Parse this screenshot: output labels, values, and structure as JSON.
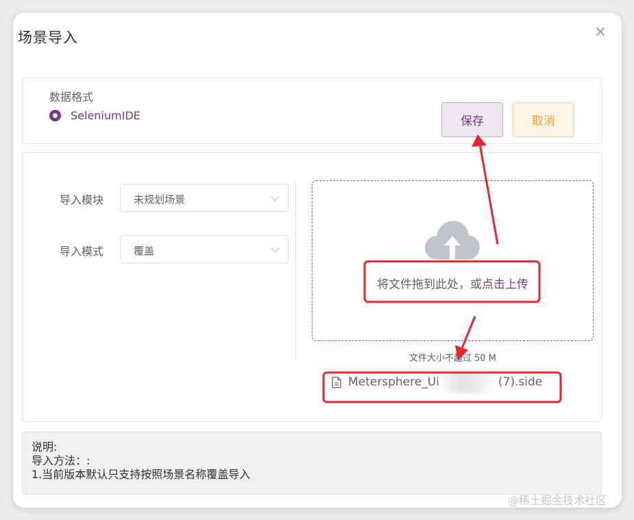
{
  "dialog": {
    "title": "场景导入",
    "close_glyph": "×"
  },
  "format": {
    "label": "数据格式",
    "option": "SeleniumIDE",
    "selected": true
  },
  "actions": {
    "save_label": "保存",
    "cancel_label": "取消"
  },
  "form": {
    "module_label": "导入模块",
    "module_value": "未规划场景",
    "mode_label": "导入模式",
    "mode_value": "覆盖"
  },
  "upload": {
    "icon": "cloud-upload-icon",
    "drop_text": "将文件拖到此处，或",
    "drop_link": "点击上传",
    "tip": "文件大小不超过 50 M",
    "file_icon": "document-icon",
    "file_prefix": "Metersphere_Ui",
    "file_suffix": "(7).side"
  },
  "notes": {
    "line1": "说明:",
    "line2": "导入方法：:",
    "line3": "1.当前版本默认只支持按照场景名称覆盖导入"
  },
  "watermark": "@稀土掘金技术社区",
  "colors": {
    "accent": "#783887",
    "warning": "#e6a23c",
    "annotation": "#e8262b"
  }
}
